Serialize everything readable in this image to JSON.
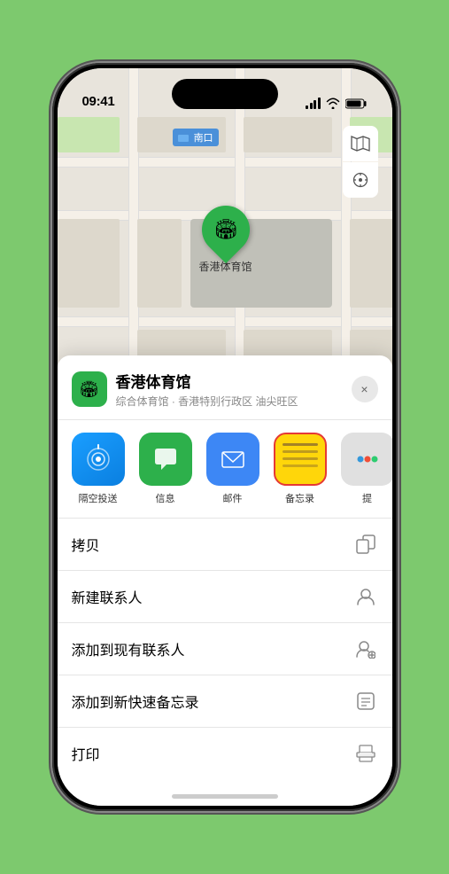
{
  "status_bar": {
    "time": "09:41",
    "location_arrow": "▶"
  },
  "map": {
    "label": "南口",
    "controls": {
      "map_icon": "🗺",
      "location_icon": "⊕"
    }
  },
  "place": {
    "name": "香港体育馆",
    "subtitle": "综合体育馆 · 香港特别行政区 油尖旺区",
    "icon": "🏟"
  },
  "share_items": [
    {
      "id": "airdrop",
      "label": "隔空投送",
      "type": "airdrop"
    },
    {
      "id": "messages",
      "label": "信息",
      "type": "messages"
    },
    {
      "id": "mail",
      "label": "邮件",
      "type": "mail"
    },
    {
      "id": "notes",
      "label": "备忘录",
      "type": "notes"
    },
    {
      "id": "more",
      "label": "提",
      "type": "more"
    }
  ],
  "actions": [
    {
      "id": "copy",
      "label": "拷贝",
      "icon": "copy"
    },
    {
      "id": "new-contact",
      "label": "新建联系人",
      "icon": "person"
    },
    {
      "id": "add-contact",
      "label": "添加到现有联系人",
      "icon": "person-add"
    },
    {
      "id": "add-note",
      "label": "添加到新快速备忘录",
      "icon": "note"
    },
    {
      "id": "print",
      "label": "打印",
      "icon": "print"
    }
  ],
  "close_label": "×"
}
